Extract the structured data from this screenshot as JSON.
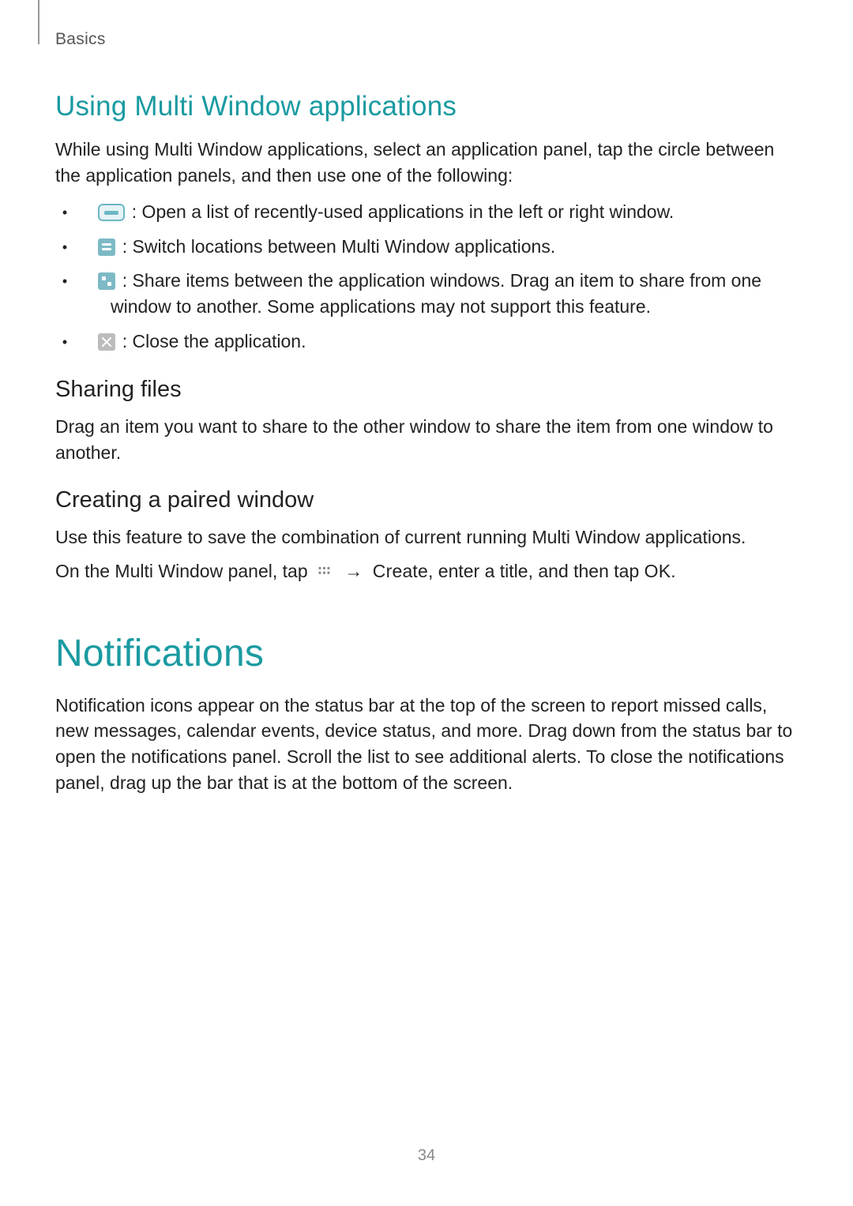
{
  "header": {
    "section": "Basics"
  },
  "sec1": {
    "title": "Using Multi Window applications",
    "intro": "While using Multi Window applications, select an application panel, tap the circle between the application panels, and then use one of the following:",
    "bullets": [
      {
        "text": ": Open a list of recently-used applications in the left or right window."
      },
      {
        "text": ": Switch locations between Multi Window applications."
      },
      {
        "text": ": Share items between the application windows. Drag an item to share from one window to another. Some applications may not support this feature."
      },
      {
        "text": ": Close the application."
      }
    ],
    "sharing": {
      "title": "Sharing files",
      "body": "Drag an item you want to share to the other window to share the item from one window to another."
    },
    "paired": {
      "title": "Creating a paired window",
      "body1": "Use this feature to save the combination of current running Multi Window applications.",
      "body2_pre": "On the Multi Window panel, tap ",
      "arrow": "→",
      "create": "Create",
      "body2_mid": ", enter a title, and then tap ",
      "ok": "OK",
      "body2_post": "."
    }
  },
  "sec2": {
    "title": "Notifications",
    "body": "Notification icons appear on the status bar at the top of the screen to report missed calls, new messages, calendar events, device status, and more. Drag down from the status bar to open the notifications panel. Scroll the list to see additional alerts. To close the notifications panel, drag up the bar that is at the bottom of the screen."
  },
  "page": "34"
}
